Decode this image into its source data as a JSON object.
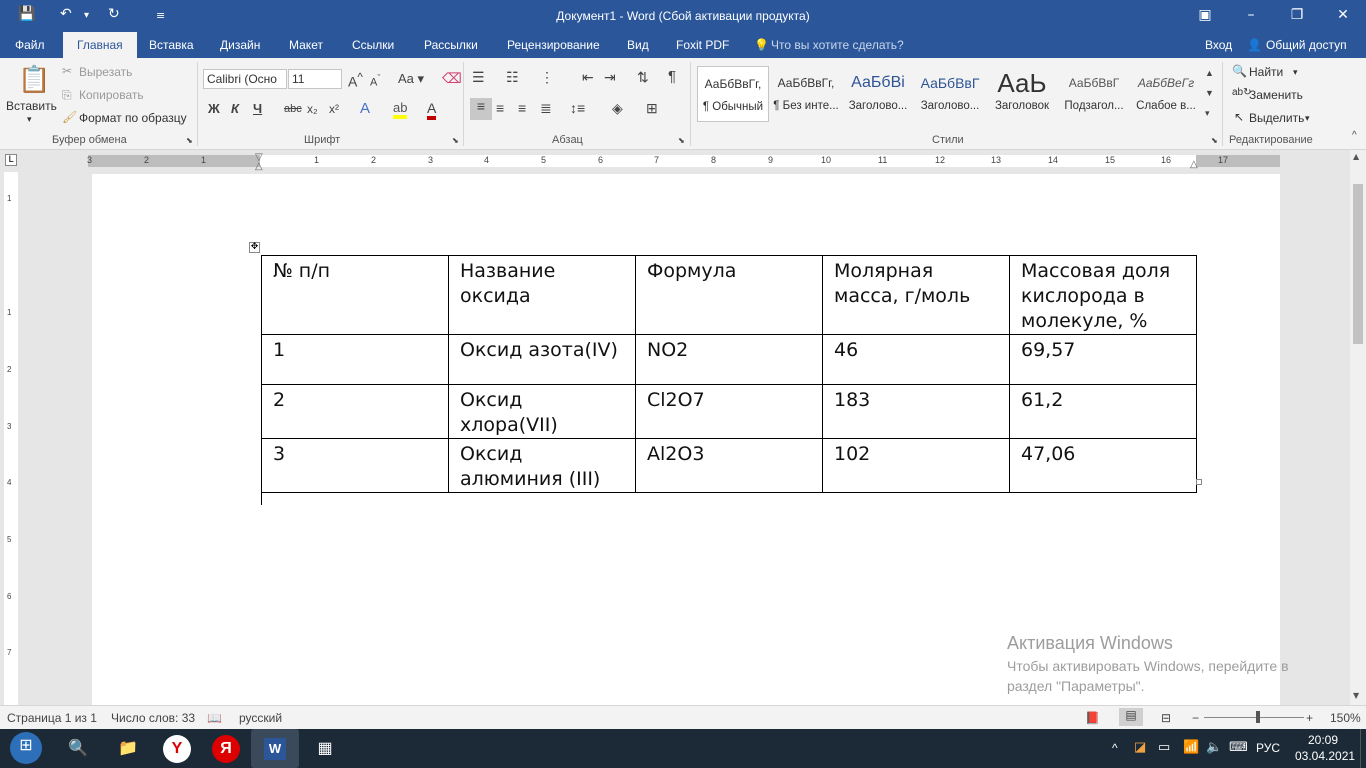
{
  "titlebar": {
    "title": "Документ1 - Word (Сбой активации продукта)",
    "save_icon": "save-icon",
    "undo_icon": "undo-icon",
    "redo_icon": "redo-icon"
  },
  "tabs": {
    "file": "Файл",
    "home": "Главная",
    "insert": "Вставка",
    "design": "Дизайн",
    "layout": "Макет",
    "references": "Ссылки",
    "mailings": "Рассылки",
    "review": "Рецензирование",
    "view": "Вид",
    "foxit": "Foxit PDF",
    "tell_me": "Что вы хотите сделать?",
    "signin": "Вход",
    "share": "Общий доступ"
  },
  "ribbon": {
    "clipboard": {
      "paste": "Вставить",
      "cut": "Вырезать",
      "copy": "Копировать",
      "format_painter": "Формат по образцу",
      "label": "Буфер обмена"
    },
    "font": {
      "name": "Calibri (Осно",
      "size": "11",
      "label": "Шрифт",
      "bold": "Ж",
      "italic": "К",
      "underline": "Ч",
      "strike": "abc",
      "sub": "x₂",
      "sup": "x²",
      "grow": "A",
      "shrink": "A",
      "case": "Aa",
      "color_a": "A"
    },
    "paragraph": {
      "label": "Абзац",
      "pilcrow": "¶"
    },
    "styles": {
      "label": "Стили",
      "items": [
        {
          "preview": "АаБбВвГг,",
          "name": "¶ Обычный"
        },
        {
          "preview": "АаБбВвГг,",
          "name": "¶ Без инте..."
        },
        {
          "preview": "АаБбВі",
          "name": "Заголово..."
        },
        {
          "preview": "АаБбВвГ",
          "name": "Заголово..."
        },
        {
          "preview": "АаЬ",
          "name": "Заголовок"
        },
        {
          "preview": "АаБбВвГ",
          "name": "Подзагол..."
        },
        {
          "preview": "АаБбВеГг",
          "name": "Слабое в..."
        }
      ]
    },
    "editing": {
      "find": "Найти",
      "replace": "Заменить",
      "select": "Выделить",
      "label": "Редактирование"
    }
  },
  "ruler": {
    "h_numbers": [
      "3",
      "2",
      "1",
      "1",
      "2",
      "3",
      "4",
      "5",
      "6",
      "7",
      "8",
      "9",
      "10",
      "11",
      "12",
      "13",
      "14",
      "15",
      "16",
      "17"
    ],
    "v_numbers": [
      "1",
      "1",
      "2",
      "3",
      "4",
      "5",
      "6",
      "7"
    ]
  },
  "document": {
    "table": [
      [
        "№ п/п",
        "Название оксида",
        "Формула",
        "Молярная масса, г/моль",
        "Массовая доля кислорода в молекуле, %"
      ],
      [
        "1",
        "Оксид азота(IV)",
        "NO2",
        "46",
        "69,57"
      ],
      [
        "2",
        "Оксид хлора(VII)",
        "Cl2O7",
        "183",
        "61,2"
      ],
      [
        "3",
        "Оксид алюминия (III)",
        "Al2O3",
        "102",
        "47,06"
      ]
    ]
  },
  "watermark": {
    "title": "Активация Windows",
    "line1": "Чтобы активировать Windows, перейдите в",
    "line2": "раздел \"Параметры\"."
  },
  "status": {
    "page": "Страница 1 из 1",
    "words": "Число слов: 33",
    "language": "русский",
    "zoom": "150%"
  },
  "taskbar": {
    "lang": "РУС",
    "time": "20:09",
    "date": "03.04.2021"
  }
}
